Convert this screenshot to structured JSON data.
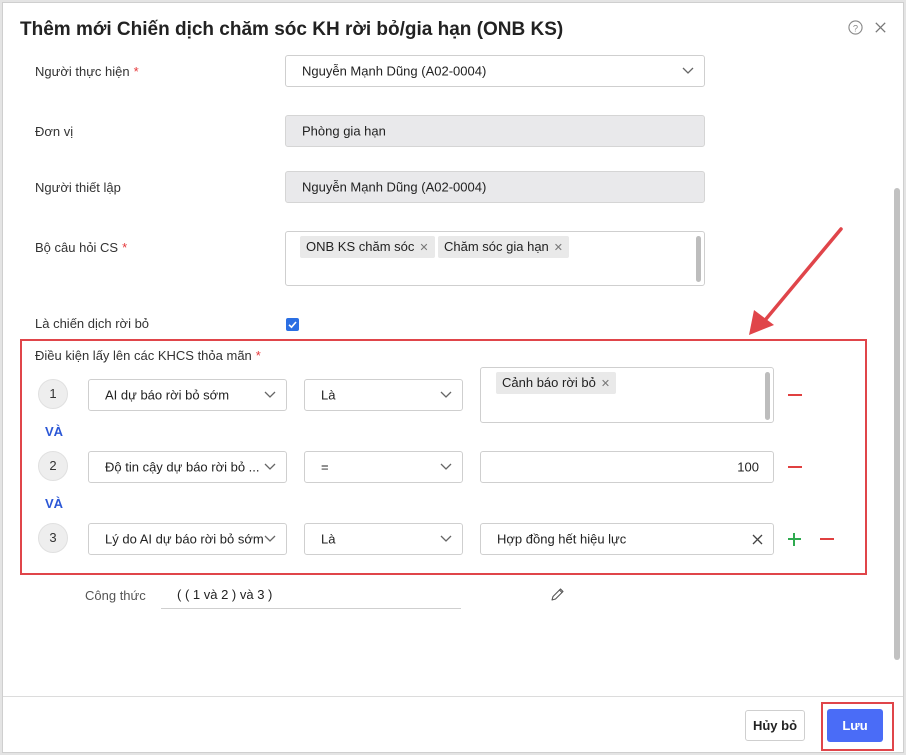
{
  "dialog": {
    "title": "Thêm mới Chiến dịch chăm sóc KH rời bỏ/gia hạn (ONB KS)"
  },
  "form": {
    "assignee": {
      "label": "Người thực hiện",
      "required_mark": "*",
      "value": "Nguyễn Mạnh Dũng (A02-0004)"
    },
    "unit": {
      "label": "Đơn vị",
      "value": "Phòng gia hạn"
    },
    "creator": {
      "label": "Người thiết lập",
      "value": "Nguyễn Mạnh Dũng (A02-0004)"
    },
    "question_set": {
      "label": "Bộ câu hỏi CS",
      "required_mark": "*",
      "tags": [
        "ONB KS chăm sóc",
        "Chăm sóc gia hạn"
      ]
    },
    "is_churn": {
      "label": "Là chiến dịch rời bỏ",
      "checked": true
    }
  },
  "conditions": {
    "label": "Điều kiện lấy lên các KHCS thỏa mãn",
    "required_mark": "*",
    "connector": "VÀ",
    "rows": [
      {
        "index": "1",
        "field": "AI dự báo rời bỏ sớm",
        "operator": "Là",
        "value_tags": [
          "Cảnh báo rời bỏ"
        ]
      },
      {
        "index": "2",
        "field": "Độ tin cậy dự báo rời bỏ ...",
        "operator": "=",
        "value": "100"
      },
      {
        "index": "3",
        "field": "Lý do AI dự báo rời bỏ sớm",
        "operator": "Là",
        "value": "Hợp đồng hết hiệu lực"
      }
    ]
  },
  "formula": {
    "label": "Công thức",
    "value": "( ( 1 và 2 ) và 3 )"
  },
  "footer": {
    "cancel_label": "Hủy bỏ",
    "save_label": "Lưu"
  },
  "colors": {
    "accent": "#4a6cf7",
    "annotation_red": "#e0454a",
    "add_green": "#2eaa4f",
    "remove_red": "#e04040"
  }
}
